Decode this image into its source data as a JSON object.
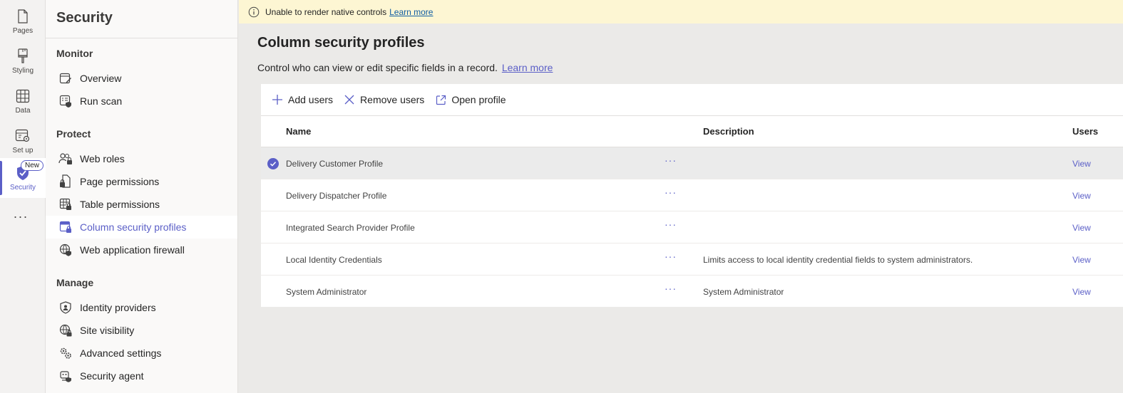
{
  "rail": {
    "items": [
      {
        "label": "Pages",
        "icon": "page-icon"
      },
      {
        "label": "Styling",
        "icon": "paintbrush-icon"
      },
      {
        "label": "Data",
        "icon": "table-icon"
      },
      {
        "label": "Set up",
        "icon": "setup-icon"
      },
      {
        "label": "Security",
        "icon": "shield-check-icon",
        "badge": "New"
      }
    ],
    "more_label": "···"
  },
  "security_pane": {
    "title": "Security",
    "sections": [
      {
        "header": "Monitor",
        "items": [
          {
            "label": "Overview",
            "icon": "overview-icon"
          },
          {
            "label": "Run scan",
            "icon": "scan-icon"
          }
        ]
      },
      {
        "header": "Protect",
        "items": [
          {
            "label": "Web roles",
            "icon": "people-lock-icon"
          },
          {
            "label": "Page permissions",
            "icon": "document-lock-icon"
          },
          {
            "label": "Table permissions",
            "icon": "table-lock-icon"
          },
          {
            "label": "Column security profiles",
            "icon": "column-lock-icon",
            "active": true
          },
          {
            "label": "Web application firewall",
            "icon": "globe-shield-icon"
          }
        ]
      },
      {
        "header": "Manage",
        "items": [
          {
            "label": "Identity providers",
            "icon": "shield-person-icon"
          },
          {
            "label": "Site visibility",
            "icon": "globe-lock-icon"
          },
          {
            "label": "Advanced settings",
            "icon": "gears-icon"
          },
          {
            "label": "Security agent",
            "icon": "bot-icon"
          }
        ]
      }
    ]
  },
  "banner": {
    "text": "Unable to render native controls",
    "link": "Learn more"
  },
  "main": {
    "title": "Column security profiles",
    "description": "Control who can view or edit specific fields in a record.",
    "description_link": "Learn more",
    "toolbar": {
      "add_users": "Add users",
      "remove_users": "Remove users",
      "open_profile": "Open profile"
    },
    "columns": [
      "Name",
      "Description",
      "Users"
    ],
    "rows": [
      {
        "name": "Delivery Customer Profile",
        "description": "",
        "users": "View",
        "selected": true
      },
      {
        "name": "Delivery Dispatcher Profile",
        "description": "",
        "users": "View"
      },
      {
        "name": "Integrated Search Provider Profile",
        "description": "",
        "users": "View"
      },
      {
        "name": "Local Identity Credentials",
        "description": "Limits access to local identity credential fields to system administrators.",
        "users": "View"
      },
      {
        "name": "System Administrator",
        "description": "System Administrator",
        "users": "View"
      }
    ],
    "row_more": "···"
  },
  "colors": {
    "accent": "#5b5fc7",
    "banner_bg": "#fdf6d3",
    "link": "#115ea3"
  }
}
